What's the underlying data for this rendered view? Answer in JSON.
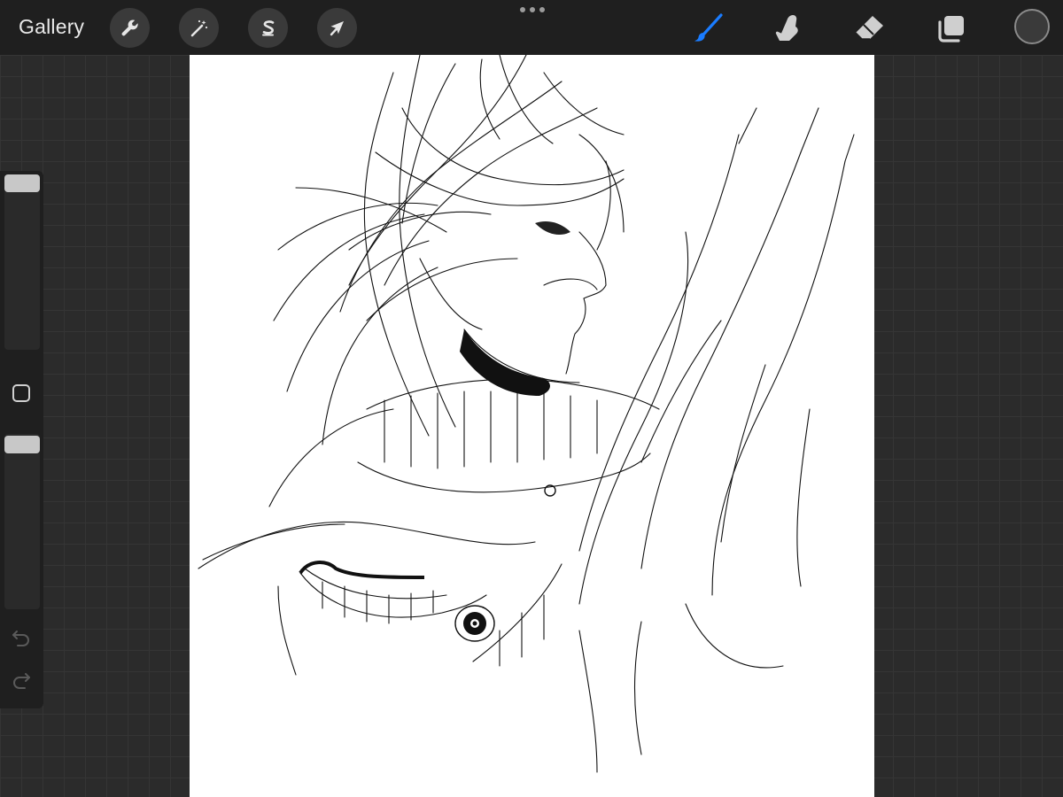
{
  "topbar": {
    "gallery_label": "Gallery",
    "left_tools": [
      {
        "name": "actions",
        "icon": "wrench-icon"
      },
      {
        "name": "adjustments",
        "icon": "magic-wand-icon"
      },
      {
        "name": "selection",
        "icon": "selection-s-icon"
      },
      {
        "name": "transform",
        "icon": "arrow-cursor-icon"
      }
    ],
    "right_tools": [
      {
        "name": "brush",
        "icon": "brush-icon",
        "active": true,
        "color": "#1a7cff"
      },
      {
        "name": "smudge",
        "icon": "smudge-finger-icon",
        "active": false
      },
      {
        "name": "eraser",
        "icon": "eraser-icon",
        "active": false
      },
      {
        "name": "layers",
        "icon": "layers-icon",
        "active": false
      }
    ],
    "current_color": "#3a3a3a"
  },
  "sidebar": {
    "brush_size_level": 1.0,
    "opacity_level": 0.95,
    "modify_icon": "square-icon",
    "undo_icon": "undo-arrow-icon",
    "redo_icon": "redo-arrow-icon"
  },
  "canvas": {
    "background": "#ffffff",
    "content": "sketch-drawing"
  },
  "colors": {
    "topbar_bg": "#1f1f1f",
    "workspace_bg": "#2b2b2b",
    "accent": "#1a7cff"
  }
}
